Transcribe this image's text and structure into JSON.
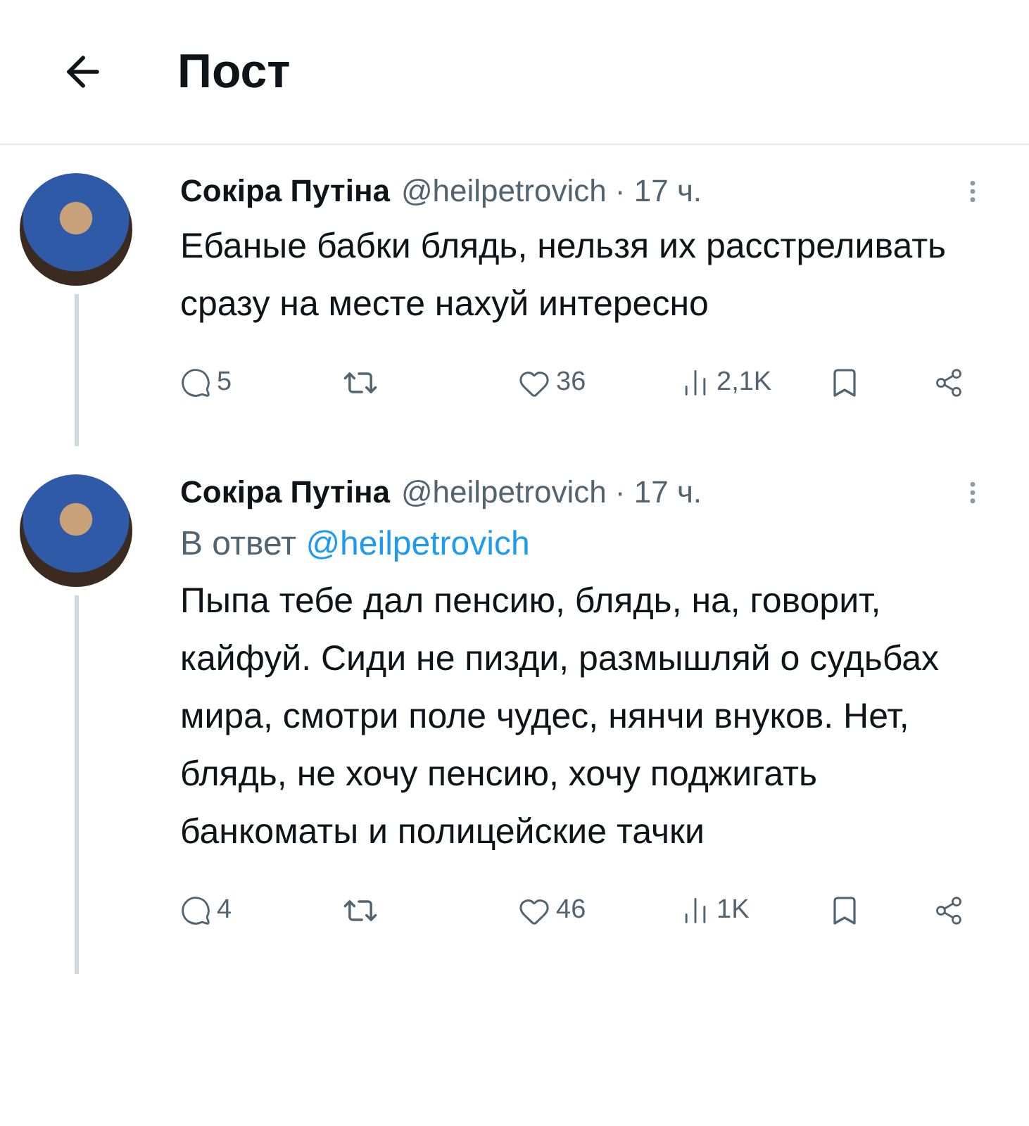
{
  "header": {
    "title": "Пост"
  },
  "posts": [
    {
      "author": "Сокіра Путіна",
      "meta": "@heilpetrovich · 17 ч.",
      "text": "Ебаные бабки блядь, нельзя их расстреливать сразу на месте нахуй интересно",
      "actions": {
        "replies": "5",
        "likes": "36",
        "views": "2,1K"
      }
    },
    {
      "author": "Сокіра Путіна",
      "meta": "@heilpetrovich · 17 ч.",
      "reply_prefix": "В ответ",
      "reply_handle": "@heilpetrovich",
      "text": "Пыпа тебе дал пенсию, блядь, на, говорит, кайфуй. Сиди не пизди, размышляй о судьбах мира, смотри поле чудес, нянчи внуков. Нет, блядь, не хочу пенсию, хочу поджигать банкоматы и полицейские тачки",
      "actions": {
        "replies": "4",
        "likes": "46",
        "views": "1K"
      }
    }
  ]
}
